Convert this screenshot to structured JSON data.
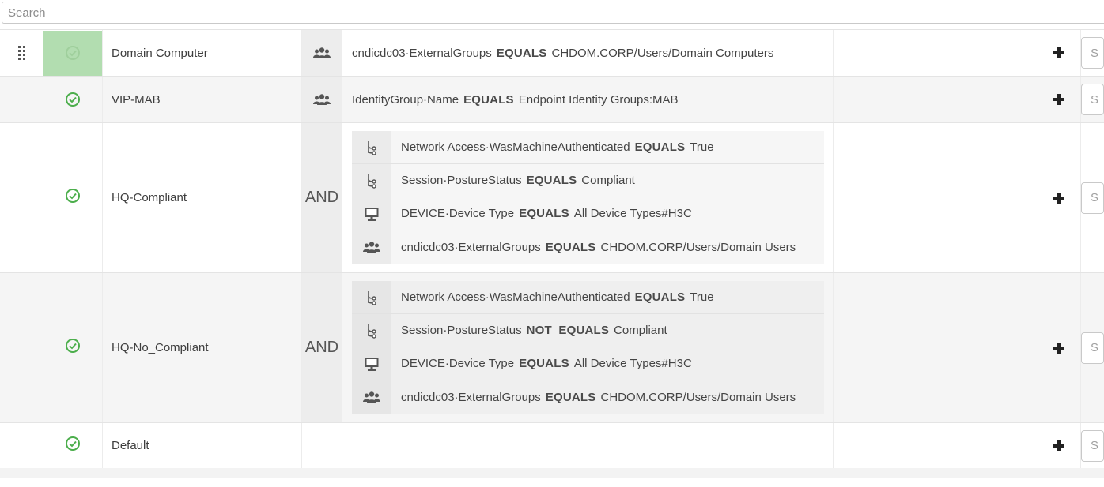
{
  "search": {
    "placeholder": "Search"
  },
  "colors": {
    "status_ok": "#4cae4c",
    "active_status_bg": "#b2ddb0",
    "operator_bg": "#ededed"
  },
  "rules": [
    {
      "name": "Domain Computer",
      "status_icon": "check-circle-icon",
      "operator": "",
      "conditions": [
        {
          "icon": "user-group-icon",
          "attribute": "cndicdc03·ExternalGroups",
          "operator": "EQUALS",
          "value": "CHDOM.CORP/Users/Domain Computers"
        }
      ],
      "select_placeholder": "S"
    },
    {
      "name": "VIP-MAB",
      "status_icon": "check-circle-icon",
      "operator": "",
      "conditions": [
        {
          "icon": "user-group-icon",
          "attribute": "IdentityGroup·Name",
          "operator": "EQUALS",
          "value": "Endpoint Identity Groups:MAB"
        }
      ],
      "select_placeholder": "S"
    },
    {
      "name": "HQ-Compliant",
      "status_icon": "check-circle-icon",
      "operator": "AND",
      "conditions": [
        {
          "icon": "hierarchy-icon",
          "attribute": "Network Access·WasMachineAuthenticated",
          "operator": "EQUALS",
          "value": "True"
        },
        {
          "icon": "hierarchy-icon",
          "attribute": "Session·PostureStatus",
          "operator": "EQUALS",
          "value": "Compliant"
        },
        {
          "icon": "monitor-icon",
          "attribute": "DEVICE·Device Type",
          "operator": "EQUALS",
          "value": "All Device Types#H3C"
        },
        {
          "icon": "user-group-icon",
          "attribute": "cndicdc03·ExternalGroups",
          "operator": "EQUALS",
          "value": "CHDOM.CORP/Users/Domain Users"
        }
      ],
      "select_placeholder": "S"
    },
    {
      "name": "HQ-No_Compliant",
      "status_icon": "check-circle-icon",
      "operator": "AND",
      "conditions": [
        {
          "icon": "hierarchy-icon",
          "attribute": "Network Access·WasMachineAuthenticated",
          "operator": "EQUALS",
          "value": "True"
        },
        {
          "icon": "hierarchy-icon",
          "attribute": "Session·PostureStatus",
          "operator": "NOT_EQUALS",
          "value": "Compliant"
        },
        {
          "icon": "monitor-icon",
          "attribute": "DEVICE·Device Type",
          "operator": "EQUALS",
          "value": "All Device Types#H3C"
        },
        {
          "icon": "user-group-icon",
          "attribute": "cndicdc03·ExternalGroups",
          "operator": "EQUALS",
          "value": "CHDOM.CORP/Users/Domain Users"
        }
      ],
      "select_placeholder": "S"
    },
    {
      "name": "Default",
      "status_icon": "check-circle-icon",
      "operator": "",
      "conditions": [],
      "select_placeholder": "S"
    }
  ]
}
